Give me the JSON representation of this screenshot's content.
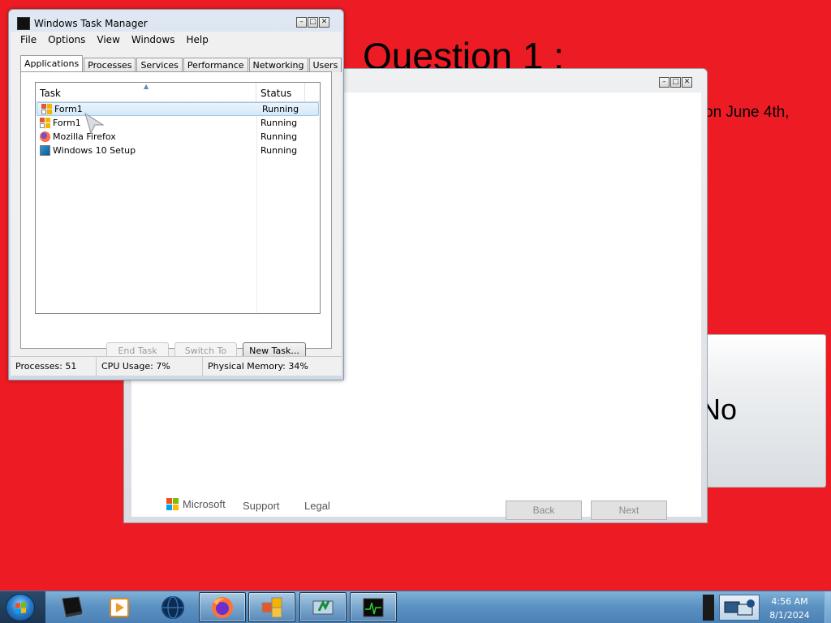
{
  "background": {
    "question_title": "Question 1 :",
    "question_fragment": "on June 4th,",
    "option_fragment": "No",
    "color": "#ed1c24"
  },
  "setup_window": {
    "caption_buttons": [
      "minimize",
      "maximize",
      "close"
    ],
    "brand": "Microsoft",
    "support_link": "Support",
    "legal_link": "Legal",
    "back_button": "Back",
    "next_button": "Next"
  },
  "task_manager": {
    "title": "Windows Task Manager",
    "menu": [
      "File",
      "Options",
      "View",
      "Windows",
      "Help"
    ],
    "tabs": [
      "Applications",
      "Processes",
      "Services",
      "Performance",
      "Networking",
      "Users"
    ],
    "active_tab": "Applications",
    "columns": {
      "task": "Task",
      "status": "Status"
    },
    "rows": [
      {
        "icon": "form-app-icon",
        "task": "Form1",
        "status": "Running",
        "selected": true
      },
      {
        "icon": "form-app-icon",
        "task": "Form1",
        "status": "Running",
        "selected": false
      },
      {
        "icon": "firefox-icon",
        "task": "Mozilla Firefox",
        "status": "Running",
        "selected": false
      },
      {
        "icon": "windows-setup-icon",
        "task": "Windows 10 Setup",
        "status": "Running",
        "selected": false
      }
    ],
    "buttons": {
      "end_task": "End Task",
      "switch_to": "Switch To",
      "new_task": "New Task..."
    },
    "status_bar": {
      "processes": "Processes: 51",
      "cpu": "CPU Usage: 7%",
      "memory": "Physical Memory: 34%"
    }
  },
  "taskbar": {
    "items": [
      {
        "name": "start-button",
        "icon": "windows-orb-icon"
      },
      {
        "name": "task-view",
        "icon": "black-monitor-icon"
      },
      {
        "name": "media-player",
        "icon": "media-player-icon"
      },
      {
        "name": "globe-app",
        "icon": "globe-icon"
      },
      {
        "name": "firefox",
        "icon": "firefox-icon"
      },
      {
        "name": "form-app",
        "icon": "form-app-icon"
      },
      {
        "name": "windows-setup",
        "icon": "windows-setup-icon"
      },
      {
        "name": "task-manager",
        "icon": "task-manager-icon"
      }
    ],
    "clock_time": "4:56 AM",
    "clock_date": "8/1/2024"
  }
}
